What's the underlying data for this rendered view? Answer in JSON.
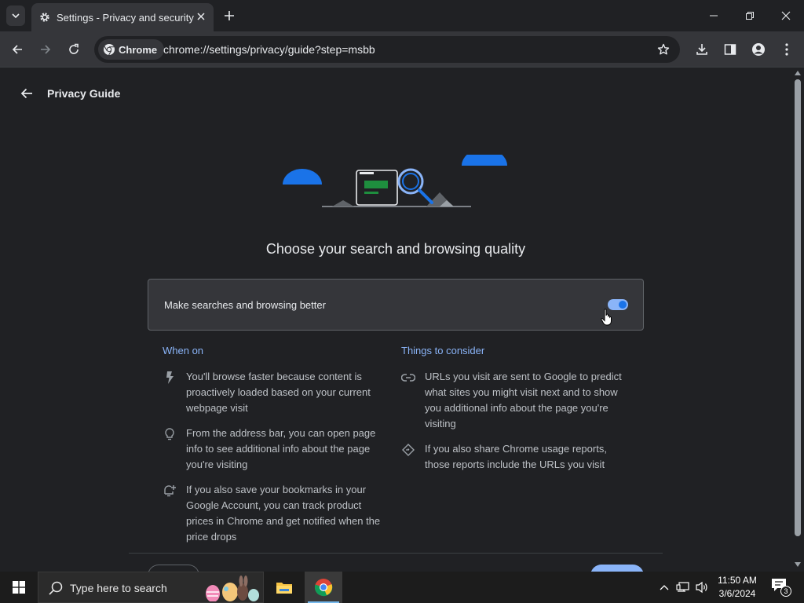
{
  "browser": {
    "tab": {
      "title": "Settings - Privacy and security"
    },
    "address": {
      "chip_label": "Chrome",
      "url": "chrome://settings/privacy/guide?step=msbb"
    }
  },
  "page": {
    "title": "Privacy Guide",
    "heading": "Choose your search and browsing quality",
    "toggle_card": {
      "label": "Make searches and browsing better",
      "enabled": true
    },
    "when_on": {
      "heading": "When on",
      "items": [
        {
          "icon": "bolt-icon",
          "text": "You'll browse faster because content is proactively loaded based on your current webpage visit"
        },
        {
          "icon": "lightbulb-icon",
          "text": "From the address bar, you can open page info to see additional info about the page you're visiting"
        },
        {
          "icon": "price-alert-icon",
          "text": "If you also save your bookmarks in your Google Account, you can track product prices in Chrome and get notified when the price drops"
        }
      ]
    },
    "things_to_consider": {
      "heading": "Things to consider",
      "items": [
        {
          "icon": "link-icon",
          "text": "URLs you visit are sent to Google to predict what sites you might visit next and to show you additional info about the page you're visiting"
        },
        {
          "icon": "diamond-icon",
          "text": "If you also share Chrome usage reports, those reports include the URLs you visit"
        }
      ]
    }
  },
  "taskbar": {
    "search_placeholder": "Type here to search",
    "time": "11:50 AM",
    "date": "3/6/2024",
    "notification_count": "3"
  },
  "colors": {
    "accent": "#8ab4f8",
    "toggle_knob": "#1a73e8",
    "background": "#202124",
    "surface": "#35363a"
  }
}
